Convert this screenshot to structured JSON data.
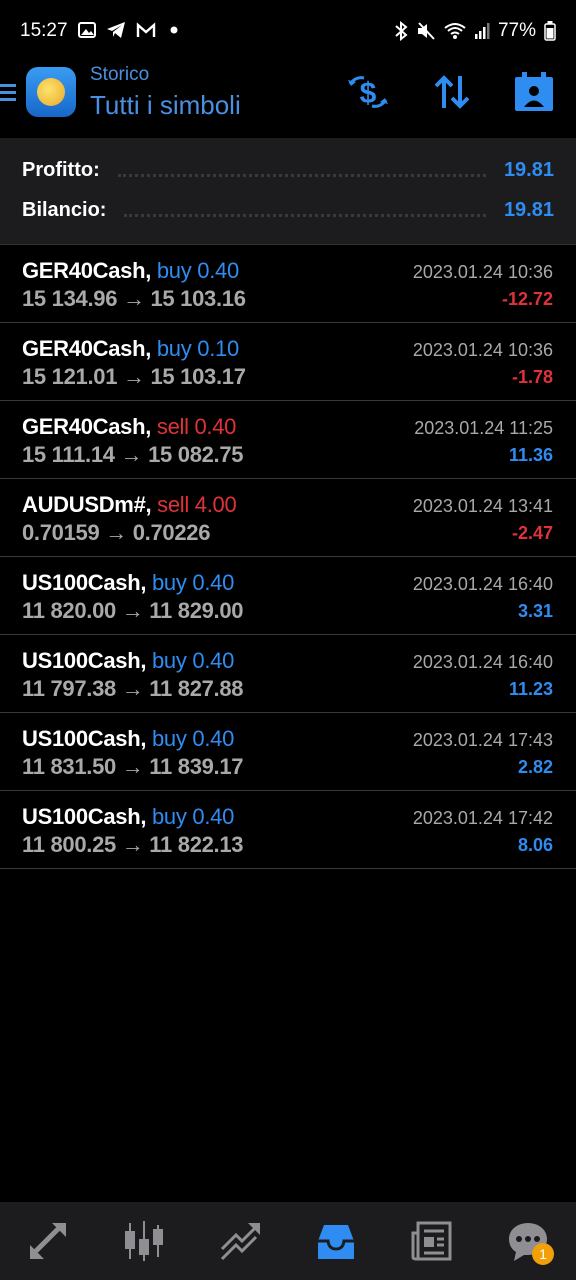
{
  "status_bar": {
    "time": "15:27",
    "battery": "77%",
    "icons_left": [
      "image-icon",
      "telegram-icon",
      "gmail-icon",
      "dot-icon"
    ],
    "icons_right": [
      "bluetooth-icon",
      "mute-icon",
      "wifi-icon",
      "signal-icon",
      "battery-icon"
    ]
  },
  "header": {
    "subtitle": "Storico",
    "title": "Tutti i simboli",
    "actions": [
      "currency-swap-icon",
      "sort-icon",
      "calendar-icon"
    ]
  },
  "summary": {
    "profit_label": "Profitto:",
    "profit_value": "19.81",
    "balance_label": "Bilancio:",
    "balance_value": "19.81"
  },
  "trades": [
    {
      "symbol": "GER40Cash,",
      "side": "buy",
      "volume": "0.40",
      "prices": "15 134.96 → 15 103.16",
      "date": "2023.01.24 10:36",
      "profit": "-12.72"
    },
    {
      "symbol": "GER40Cash,",
      "side": "buy",
      "volume": "0.10",
      "prices": "15 121.01 → 15 103.17",
      "date": "2023.01.24 10:36",
      "profit": "-1.78"
    },
    {
      "symbol": "GER40Cash,",
      "side": "sell",
      "volume": "0.40",
      "prices": "15 111.14 → 15 082.75",
      "date": "2023.01.24 11:25",
      "profit": "11.36"
    },
    {
      "symbol": "AUDUSDm#,",
      "side": "sell",
      "volume": "4.00",
      "prices": "0.70159 → 0.70226",
      "date": "2023.01.24 13:41",
      "profit": "-2.47"
    },
    {
      "symbol": "US100Cash,",
      "side": "buy",
      "volume": "0.40",
      "prices": "11 820.00 → 11 829.00",
      "date": "2023.01.24 16:40",
      "profit": "3.31"
    },
    {
      "symbol": "US100Cash,",
      "side": "buy",
      "volume": "0.40",
      "prices": "11 797.38 → 11 827.88",
      "date": "2023.01.24 16:40",
      "profit": "11.23"
    },
    {
      "symbol": "US100Cash,",
      "side": "buy",
      "volume": "0.40",
      "prices": "11 831.50 → 11 839.17",
      "date": "2023.01.24 17:43",
      "profit": "2.82"
    },
    {
      "symbol": "US100Cash,",
      "side": "buy",
      "volume": "0.40",
      "prices": "11 800.25 → 11 822.13",
      "date": "2023.01.24 17:42",
      "profit": "8.06"
    }
  ],
  "bottom_nav": {
    "items": [
      "quotes-icon",
      "chart-icon",
      "trade-icon",
      "history-icon",
      "news-icon",
      "chat-icon"
    ],
    "active": "history-icon",
    "chat_badge": "1"
  },
  "colors": {
    "accent": "#2f8cf0",
    "negative": "#e0323a",
    "background": "#000000",
    "panel": "#1c1c1e"
  }
}
